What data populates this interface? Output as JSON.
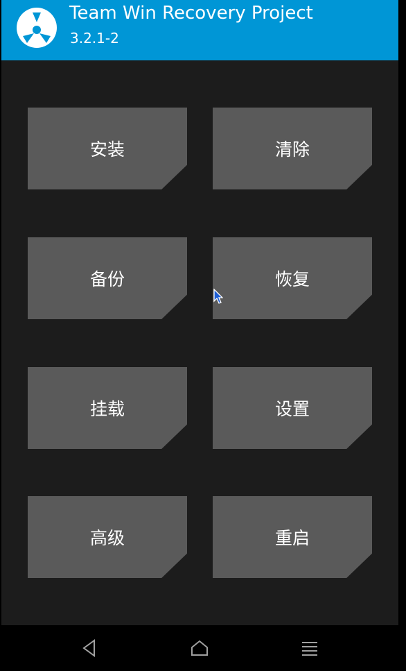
{
  "header": {
    "title": "Team Win Recovery Project",
    "version": "3.2.1-2",
    "background_color": "#0096d6",
    "logo_icon": "twrp-logo-icon"
  },
  "menu": {
    "install": "安装",
    "wipe": "清除",
    "backup": "备份",
    "restore": "恢复",
    "mount": "挂载",
    "settings": "设置",
    "advanced": "高级",
    "reboot": "重启"
  },
  "navbar": {
    "back_icon": "back-triangle-icon",
    "home_icon": "home-icon",
    "menu_icon": "menu-lines-icon"
  },
  "colors": {
    "panel": "#1c1c1c",
    "tile": "#5a5a5a",
    "text": "#ffffff"
  }
}
